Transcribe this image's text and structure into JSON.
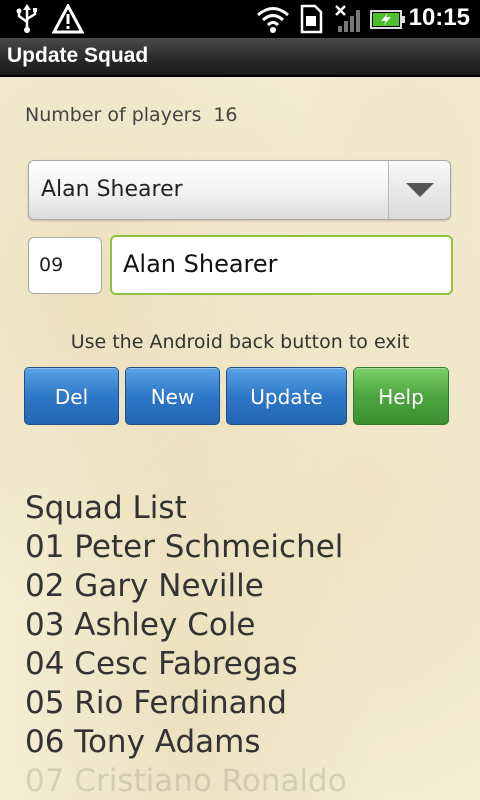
{
  "status_bar": {
    "time": "10:15",
    "icons": [
      "usb-icon",
      "warning-icon",
      "wifi-icon",
      "sim-icon",
      "signal-icon",
      "battery-charging-icon"
    ]
  },
  "app": {
    "title": "Update Squad"
  },
  "form": {
    "players_label": "Number of players",
    "players_count": "16",
    "selected_player": "Alan Shearer",
    "number_value": "09",
    "name_value": "Alan Shearer",
    "hint": "Use the Android back button to exit"
  },
  "buttons": {
    "del": "Del",
    "new": "New",
    "update": "Update",
    "help": "Help"
  },
  "colors": {
    "blue_button": "#2f78c8",
    "green_button": "#4ea53f",
    "input_focus": "#8ec23e",
    "background": "#f4ecd4"
  },
  "squad": {
    "heading": "Squad List",
    "items": [
      "01 Peter Schmeichel",
      "02 Gary Neville",
      "03 Ashley Cole",
      "04 Cesc Fabregas",
      "05 Rio Ferdinand",
      "06 Tony Adams",
      "07 Cristiano Ronaldo"
    ]
  }
}
